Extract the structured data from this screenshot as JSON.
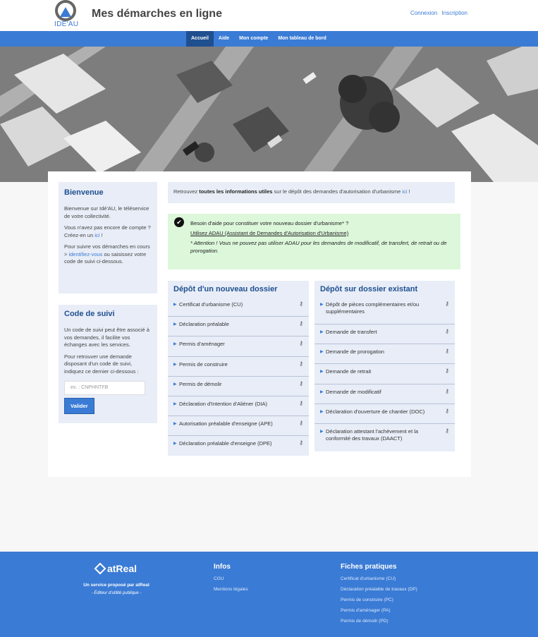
{
  "header": {
    "logo_text": "IDE'AU",
    "site_title": "Mes démarches en ligne",
    "login": "Connexion",
    "register": "Inscription"
  },
  "nav": [
    "Accueil",
    "Aide",
    "Mon compte",
    "Mon tableau de bord"
  ],
  "welcome": {
    "title": "Bienvenue",
    "p1": "Bienvenue sur Idé'AU, le téléservice de votre collectivité.",
    "p2_before": "Vous n'avez pas encore de compte ? Créez-en un ",
    "p2_link": "ici",
    "p2_after": " !",
    "p3_before": "Pour suivre vos démarches en cours > ",
    "p3_link": "identifiez-vous",
    "p3_after": " ou saisissez votre code de suivi ci-dessous."
  },
  "tracking": {
    "title": "Code de suivi",
    "p1": "Un code de suivi peut être associé à vos demandes, il facilite vos échanges avec les services.",
    "p2": "Pour retrouver une demande disposant d'un code de suivi, indiquez ce dernier ci-dessous :",
    "placeholder": "ex. : CNPHNTFB",
    "button": "Valider"
  },
  "info_bar": {
    "before": "Retrouvez ",
    "bold": "toutes les informations utiles",
    "middle": " sur le dépôt des demandes d'autorisation d'urbanisme ",
    "link": "ici",
    "after": " !"
  },
  "help": {
    "question": "Besoin d'aide pour constituer votre nouveau dossier d'urbanisme* ?",
    "link": "Utilisez ADAU (Assistant de Demandes d'Autorisation d'Urbanisme)",
    "note": "* Attention ! Vous ne pouvez pas utiliser ADAU pour les demandes de modificatif, de transfert, de retrait ou de prorogation."
  },
  "new_file": {
    "title": "Dépôt d'un nouveau dossier",
    "items": [
      "Certificat d'urbanisme (CU)",
      "Déclaration préalable",
      "Permis d'aménager",
      "Permis de construire",
      "Permis de démolir",
      "Déclaration d'Intention d'Aliéner (DIA)",
      "Autorisation préalable d'enseigne (APE)",
      "Déclaration préalable d'enseigne (DPE)"
    ]
  },
  "existing_file": {
    "title": "Dépôt sur dossier existant",
    "items": [
      "Dépôt de pièces complémentaires et/ou supplémentaires",
      "Demande de transfert",
      "Demande de prorogation",
      "Demande de retrait",
      "Demande de modificatif",
      "Déclaration d'ouverture de chantier (DOC)",
      "Déclaration attestant l'achèvement et la conformité des travaux (DAACT)"
    ]
  },
  "footer": {
    "brand": "atReal",
    "by": "Un service proposé par atReal",
    "tag": "- Éditeur d'utilité publique -",
    "infos_title": "Infos",
    "infos_links": [
      "CGU",
      "Mentions légales"
    ],
    "fiches_title": "Fiches pratiques",
    "fiches_links": [
      "Certificat d'urbanisme (CU)",
      "Déclaration préalable de travaux (DP)",
      "Permis de construire (PC)",
      "Permis d'aménager (PA)",
      "Permis de démolir (PD)"
    ]
  },
  "colors": {
    "primary": "#3a7bd5",
    "nav_active": "#1f4f8f",
    "panel_bg": "#e8edf7",
    "help_bg": "#dcf7da"
  }
}
